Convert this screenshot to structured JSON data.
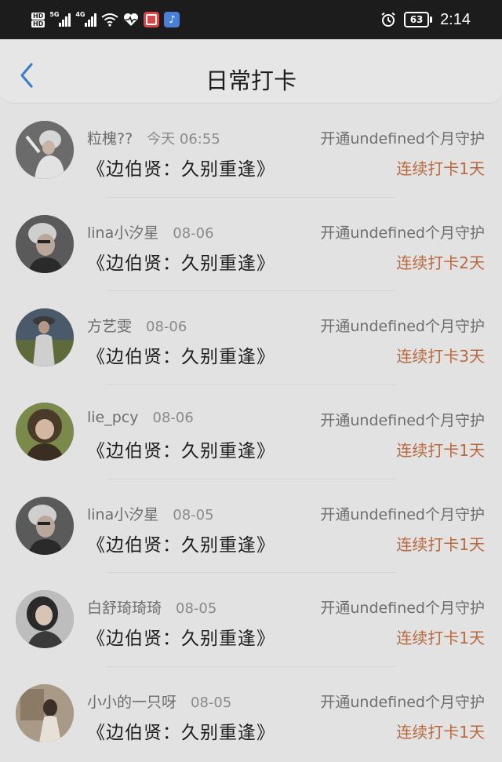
{
  "status_bar": {
    "hd_top": "HD",
    "hd_bottom": "HD",
    "net1": "5G",
    "net2": "4G",
    "battery": "63",
    "time": "2:14"
  },
  "header": {
    "title": "日常打卡"
  },
  "rows": [
    {
      "name": "粒槐??",
      "time": "今天 06:55",
      "guard": "开通undefined个月守护",
      "book": "《边伯贤：久别重逢》",
      "streak": "连续打卡1天"
    },
    {
      "name": "lina小汐星",
      "time": "08-06",
      "guard": "开通undefined个月守护",
      "book": "《边伯贤：久别重逢》",
      "streak": "连续打卡2天"
    },
    {
      "name": "方艺雯",
      "time": "08-06",
      "guard": "开通undefined个月守护",
      "book": "《边伯贤：久别重逢》",
      "streak": "连续打卡3天"
    },
    {
      "name": "lie_pcy",
      "time": "08-06",
      "guard": "开通undefined个月守护",
      "book": "《边伯贤：久别重逢》",
      "streak": "连续打卡1天"
    },
    {
      "name": "lina小汐星",
      "time": "08-05",
      "guard": "开通undefined个月守护",
      "book": "《边伯贤：久别重逢》",
      "streak": "连续打卡1天"
    },
    {
      "name": "白舒琦琦琦",
      "time": "08-05",
      "guard": "开通undefined个月守护",
      "book": "《边伯贤：久别重逢》",
      "streak": "连续打卡1天"
    },
    {
      "name": "小小的一只呀",
      "time": "08-05",
      "guard": "开通undefined个月守护",
      "book": "《边伯贤：久别重逢》",
      "streak": "连续打卡1天"
    }
  ],
  "colors": {
    "accent_streak": "#b8693f",
    "back_arrow": "#3d80c4"
  }
}
